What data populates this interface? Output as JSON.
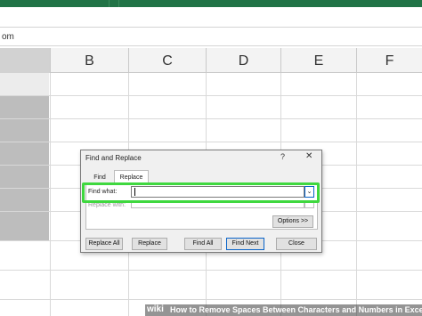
{
  "formula_bar": {
    "text": "om"
  },
  "columns": [
    {
      "label": ""
    },
    {
      "label": "B"
    },
    {
      "label": "C"
    },
    {
      "label": "D"
    },
    {
      "label": "E"
    },
    {
      "label": "F"
    }
  ],
  "dialog": {
    "title": "Find and Replace",
    "help": "?",
    "close_glyph": "✕",
    "tabs": [
      {
        "label": "Find"
      },
      {
        "label": "Replace"
      }
    ],
    "active_tab": "Replace",
    "find_label": "Find what:",
    "find_value": "",
    "replace_label": "Replace with:",
    "dropdown_glyph": "⌄",
    "buttons": {
      "options": "Options >>",
      "replace_all": "Replace All",
      "replace": "Replace",
      "find_all": "Find All",
      "find_next": "Find Next",
      "close": "Close"
    },
    "highlight_color": "#3fd83f"
  },
  "watermark": {
    "brand": "wiki",
    "text": "How to Remove Spaces Between Characters and Numbers in Excel"
  },
  "colors": {
    "ribbon": "#217346",
    "selected_column": "#bdbdbd",
    "grid_line": "#d9d9d9",
    "highlight": "#3fd83f"
  }
}
